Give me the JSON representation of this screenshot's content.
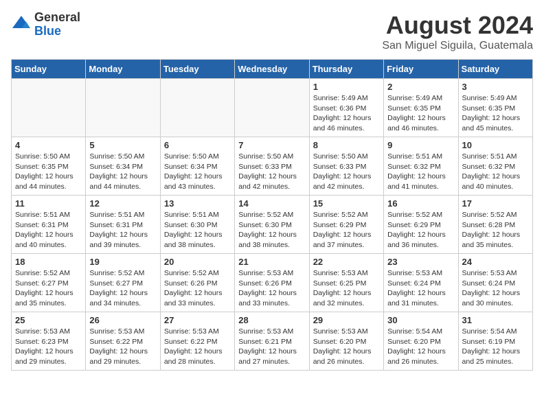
{
  "logo": {
    "general": "General",
    "blue": "Blue"
  },
  "header": {
    "month": "August 2024",
    "location": "San Miguel Siguila, Guatemala"
  },
  "weekdays": [
    "Sunday",
    "Monday",
    "Tuesday",
    "Wednesday",
    "Thursday",
    "Friday",
    "Saturday"
  ],
  "weeks": [
    [
      {
        "day": "",
        "info": ""
      },
      {
        "day": "",
        "info": ""
      },
      {
        "day": "",
        "info": ""
      },
      {
        "day": "",
        "info": ""
      },
      {
        "day": "1",
        "info": "Sunrise: 5:49 AM\nSunset: 6:36 PM\nDaylight: 12 hours\nand 46 minutes."
      },
      {
        "day": "2",
        "info": "Sunrise: 5:49 AM\nSunset: 6:35 PM\nDaylight: 12 hours\nand 46 minutes."
      },
      {
        "day": "3",
        "info": "Sunrise: 5:49 AM\nSunset: 6:35 PM\nDaylight: 12 hours\nand 45 minutes."
      }
    ],
    [
      {
        "day": "4",
        "info": "Sunrise: 5:50 AM\nSunset: 6:35 PM\nDaylight: 12 hours\nand 44 minutes."
      },
      {
        "day": "5",
        "info": "Sunrise: 5:50 AM\nSunset: 6:34 PM\nDaylight: 12 hours\nand 44 minutes."
      },
      {
        "day": "6",
        "info": "Sunrise: 5:50 AM\nSunset: 6:34 PM\nDaylight: 12 hours\nand 43 minutes."
      },
      {
        "day": "7",
        "info": "Sunrise: 5:50 AM\nSunset: 6:33 PM\nDaylight: 12 hours\nand 42 minutes."
      },
      {
        "day": "8",
        "info": "Sunrise: 5:50 AM\nSunset: 6:33 PM\nDaylight: 12 hours\nand 42 minutes."
      },
      {
        "day": "9",
        "info": "Sunrise: 5:51 AM\nSunset: 6:32 PM\nDaylight: 12 hours\nand 41 minutes."
      },
      {
        "day": "10",
        "info": "Sunrise: 5:51 AM\nSunset: 6:32 PM\nDaylight: 12 hours\nand 40 minutes."
      }
    ],
    [
      {
        "day": "11",
        "info": "Sunrise: 5:51 AM\nSunset: 6:31 PM\nDaylight: 12 hours\nand 40 minutes."
      },
      {
        "day": "12",
        "info": "Sunrise: 5:51 AM\nSunset: 6:31 PM\nDaylight: 12 hours\nand 39 minutes."
      },
      {
        "day": "13",
        "info": "Sunrise: 5:51 AM\nSunset: 6:30 PM\nDaylight: 12 hours\nand 38 minutes."
      },
      {
        "day": "14",
        "info": "Sunrise: 5:52 AM\nSunset: 6:30 PM\nDaylight: 12 hours\nand 38 minutes."
      },
      {
        "day": "15",
        "info": "Sunrise: 5:52 AM\nSunset: 6:29 PM\nDaylight: 12 hours\nand 37 minutes."
      },
      {
        "day": "16",
        "info": "Sunrise: 5:52 AM\nSunset: 6:29 PM\nDaylight: 12 hours\nand 36 minutes."
      },
      {
        "day": "17",
        "info": "Sunrise: 5:52 AM\nSunset: 6:28 PM\nDaylight: 12 hours\nand 35 minutes."
      }
    ],
    [
      {
        "day": "18",
        "info": "Sunrise: 5:52 AM\nSunset: 6:27 PM\nDaylight: 12 hours\nand 35 minutes."
      },
      {
        "day": "19",
        "info": "Sunrise: 5:52 AM\nSunset: 6:27 PM\nDaylight: 12 hours\nand 34 minutes."
      },
      {
        "day": "20",
        "info": "Sunrise: 5:52 AM\nSunset: 6:26 PM\nDaylight: 12 hours\nand 33 minutes."
      },
      {
        "day": "21",
        "info": "Sunrise: 5:53 AM\nSunset: 6:26 PM\nDaylight: 12 hours\nand 33 minutes."
      },
      {
        "day": "22",
        "info": "Sunrise: 5:53 AM\nSunset: 6:25 PM\nDaylight: 12 hours\nand 32 minutes."
      },
      {
        "day": "23",
        "info": "Sunrise: 5:53 AM\nSunset: 6:24 PM\nDaylight: 12 hours\nand 31 minutes."
      },
      {
        "day": "24",
        "info": "Sunrise: 5:53 AM\nSunset: 6:24 PM\nDaylight: 12 hours\nand 30 minutes."
      }
    ],
    [
      {
        "day": "25",
        "info": "Sunrise: 5:53 AM\nSunset: 6:23 PM\nDaylight: 12 hours\nand 29 minutes."
      },
      {
        "day": "26",
        "info": "Sunrise: 5:53 AM\nSunset: 6:22 PM\nDaylight: 12 hours\nand 29 minutes."
      },
      {
        "day": "27",
        "info": "Sunrise: 5:53 AM\nSunset: 6:22 PM\nDaylight: 12 hours\nand 28 minutes."
      },
      {
        "day": "28",
        "info": "Sunrise: 5:53 AM\nSunset: 6:21 PM\nDaylight: 12 hours\nand 27 minutes."
      },
      {
        "day": "29",
        "info": "Sunrise: 5:53 AM\nSunset: 6:20 PM\nDaylight: 12 hours\nand 26 minutes."
      },
      {
        "day": "30",
        "info": "Sunrise: 5:54 AM\nSunset: 6:20 PM\nDaylight: 12 hours\nand 26 minutes."
      },
      {
        "day": "31",
        "info": "Sunrise: 5:54 AM\nSunset: 6:19 PM\nDaylight: 12 hours\nand 25 minutes."
      }
    ]
  ]
}
